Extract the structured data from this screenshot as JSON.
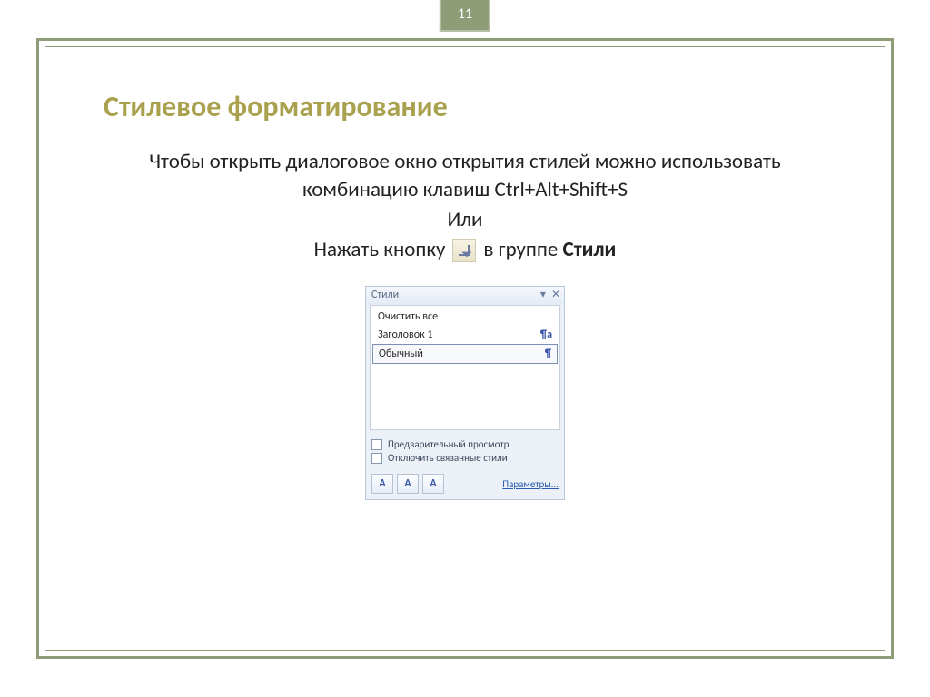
{
  "page_number": "11",
  "title": "Стилевое форматирование",
  "body": {
    "line1": "Чтобы открыть диалоговое окно открытия стилей можно использовать комбинацию клавиш  Ctrl+Alt+Shift+S",
    "line2": "Или",
    "line3_before": "Нажать кнопку",
    "line3_after_prefix": "в группе ",
    "line3_after_bold": "Стили"
  },
  "launcher_icon_name": "dialog-launcher-icon",
  "styles_pane": {
    "title": "Стили",
    "controls": {
      "menu": "▾",
      "close": "✕"
    },
    "items": [
      {
        "label": "Очистить все",
        "mark": "",
        "underline": false,
        "selected": false
      },
      {
        "label": "Заголовок 1",
        "mark": "¶a",
        "underline": true,
        "selected": false
      },
      {
        "label": "Обычный",
        "mark": "¶",
        "underline": false,
        "selected": true
      }
    ],
    "checkbox1": "Предварительный просмотр",
    "checkbox2": "Отключить связанные стили",
    "footer_buttons": [
      "A",
      "A",
      "A"
    ],
    "params_link": "Параметры..."
  }
}
